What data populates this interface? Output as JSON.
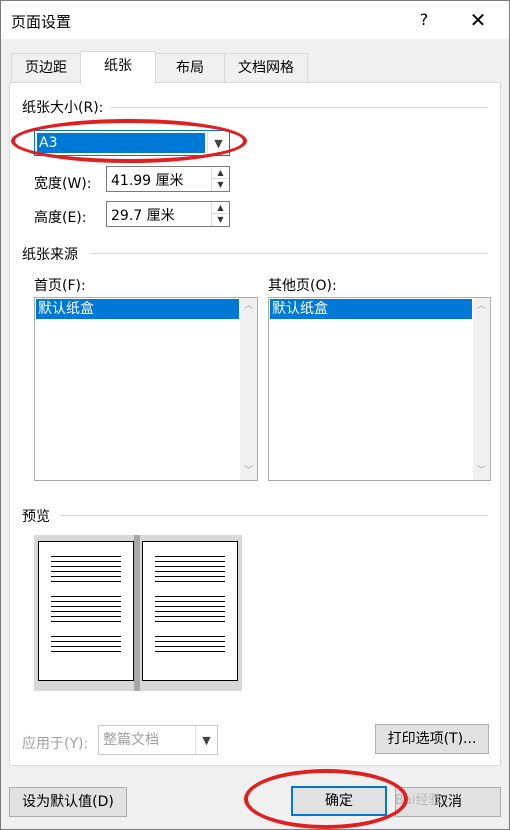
{
  "window": {
    "title": "页面设置",
    "help": "?",
    "close": "✕"
  },
  "tabs": [
    {
      "label": "页边距",
      "active": false
    },
    {
      "label": "纸张",
      "active": true
    },
    {
      "label": "布局",
      "active": false
    },
    {
      "label": "文档网格",
      "active": false
    }
  ],
  "paper_size": {
    "group_label": "纸张大小(R):",
    "selected": "A3",
    "width_label": "宽度(W):",
    "width_value": "41.99 厘米",
    "height_label": "高度(E):",
    "height_value": "29.7 厘米"
  },
  "paper_source": {
    "group_label": "纸张来源",
    "first_page_label": "首页(F):",
    "first_page_items": [
      "默认纸盒"
    ],
    "other_pages_label": "其他页(O):",
    "other_pages_items": [
      "默认纸盒"
    ]
  },
  "preview": {
    "group_label": "预览"
  },
  "apply": {
    "label": "应用于(Y):",
    "selected": "整篇文档",
    "print_options": "打印选项(T)..."
  },
  "footer": {
    "set_default": "设为默认值(D)",
    "ok": "确定",
    "cancel": "取消"
  },
  "watermark": "Bai经验",
  "colors": {
    "accent": "#0078d7",
    "annotation": "#e02020"
  }
}
